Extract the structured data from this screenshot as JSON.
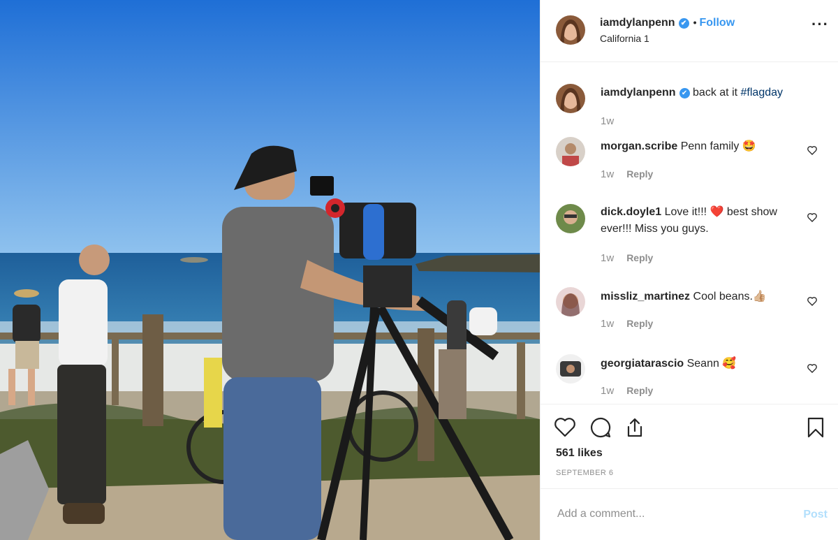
{
  "post": {
    "username": "iamdylanpenn",
    "location": "California 1",
    "follow_label": "Follow",
    "separator": "•",
    "more_label": "···",
    "verified_icon": "✔"
  },
  "caption": {
    "username": "iamdylanpenn",
    "text": "back at it ",
    "hashtag": "#flagday",
    "time": "1w"
  },
  "comments": [
    {
      "username": "morgan.scribe",
      "text": "Penn family 🤩",
      "time": "1w",
      "reply": "Reply"
    },
    {
      "username": "dick.doyle1",
      "text": "Love it!!! ❤️ best show ever!!! Miss you guys.",
      "time": "1w",
      "reply": "Reply"
    },
    {
      "username": "missliz_martinez",
      "text": "Cool beans.👍🏼",
      "time": "1w",
      "reply": "Reply"
    },
    {
      "username": "georgiatarascio",
      "text": "Seann 🥰",
      "time": "1w",
      "reply": "Reply"
    }
  ],
  "actions": {
    "icons": [
      "heart-icon",
      "comment-icon",
      "share-icon",
      "bookmark-icon"
    ]
  },
  "likes": "561 likes",
  "date": "SEPTEMBER 6",
  "add_comment": {
    "placeholder": "Add a comment...",
    "post_label": "Post"
  },
  "colors": {
    "link_blue": "#3897f0",
    "hashtag": "#003569",
    "muted": "#8e8e8e",
    "post_disabled": "#b2dffc"
  }
}
